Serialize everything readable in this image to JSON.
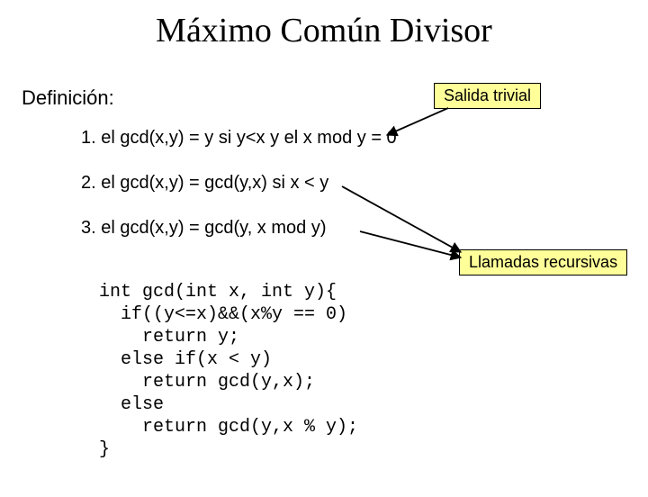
{
  "title": "Máximo Común Divisor",
  "definition_label": "Definición:",
  "callouts": {
    "trivial": "Salida trivial",
    "recursive": "Llamadas recursivas"
  },
  "rules": {
    "r1": "1. el gcd(x,y) = y si y<x y el x mod y  = 0",
    "r2": "2. el gcd(x,y) = gcd(y,x) si x < y",
    "r3": "3. el gcd(x,y) = gcd(y, x mod y)"
  },
  "code": "int gcd(int x, int y){\n  if((y<=x)&&(x%y == 0)\n    return y;\n  else if(x < y)\n    return gcd(y,x);\n  else\n    return gcd(y,x % y);\n}"
}
